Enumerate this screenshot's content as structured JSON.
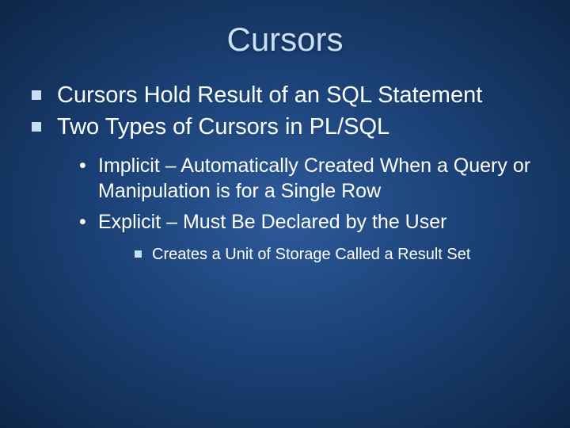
{
  "title": "Cursors",
  "bullets": {
    "item1": "Cursors Hold Result of an SQL Statement",
    "item2": "Two Types of Cursors in PL/SQL",
    "sub1": "Implicit – Automatically Created When a Query or Manipulation is for a Single Row",
    "sub2": "Explicit – Must Be Declared by the User",
    "subsub1": "Creates a Unit of Storage Called a Result Set"
  }
}
